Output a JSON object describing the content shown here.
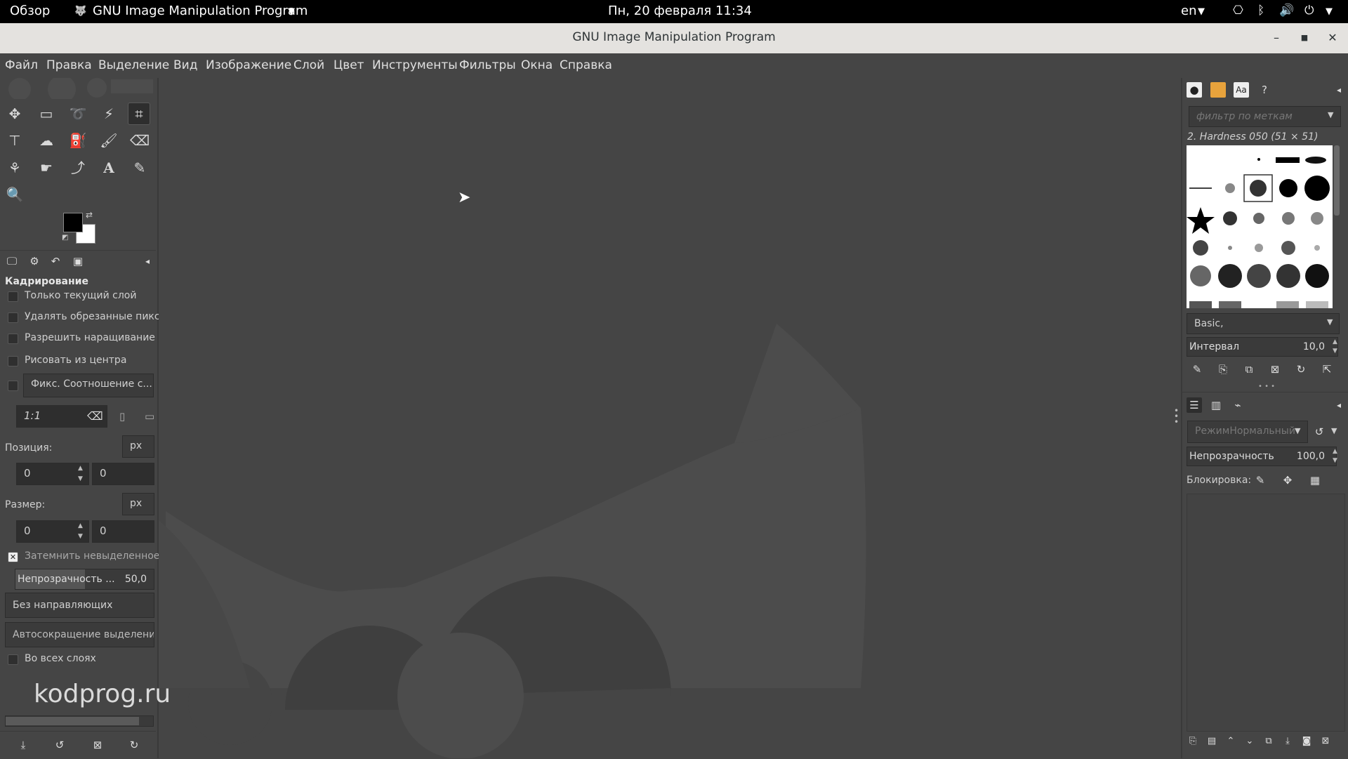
{
  "topbar": {
    "activities": "Обзор",
    "app_menu": "GNU Image Manipulation Program",
    "datetime": "Пн, 20 февраля  11:34",
    "lang": "en"
  },
  "window": {
    "title": "GNU Image Manipulation Program"
  },
  "menu": [
    "Файл",
    "Правка",
    "Выделение",
    "Вид",
    "Изображение",
    "Слой",
    "Цвет",
    "Инструменты",
    "Фильтры",
    "Окна",
    "Справка"
  ],
  "tool_options": {
    "title": "Кадрирование",
    "current_layer_only": "Только текущий слой",
    "delete_cropped": "Удалять обрезанные пиксе",
    "allow_growing": "Разрешить наращивание",
    "expand_from_center": "Рисовать из центра",
    "fixed_ratio": "Фикс. Соотношение с...",
    "ratio_value": "1:1",
    "position_label": "Позиция:",
    "position_unit": "px",
    "position_x": "0",
    "position_y": "0",
    "size_label": "Размер:",
    "size_unit": "px",
    "size_w": "0",
    "size_h": "0",
    "highlight": "Затемнить невыделенное",
    "opacity_label": "Непрозрачность ...",
    "opacity_value": "50,0",
    "opacity_fraction": 0.5,
    "guides": "Без направляющих",
    "auto_shrink": "Автосокращение выделения",
    "all_layers": "Во всех слоях"
  },
  "brushes": {
    "filter_placeholder": "фильтр по меткам",
    "selected": "2. Hardness 050 (51 × 51)",
    "preset": "Basic,",
    "interval_label": "Интервал",
    "interval_value": "10,0"
  },
  "layers": {
    "mode": "РежимНормальный",
    "opacity_label": "Непрозрачность",
    "opacity_value": "100,0",
    "lock_label": "Блокировка:"
  },
  "watermark": "kodprog.ru",
  "colors": {
    "bg": "#454545",
    "canvas_logo": "#4e4e4e",
    "foreground": "#000000",
    "background": "#ffffff"
  }
}
